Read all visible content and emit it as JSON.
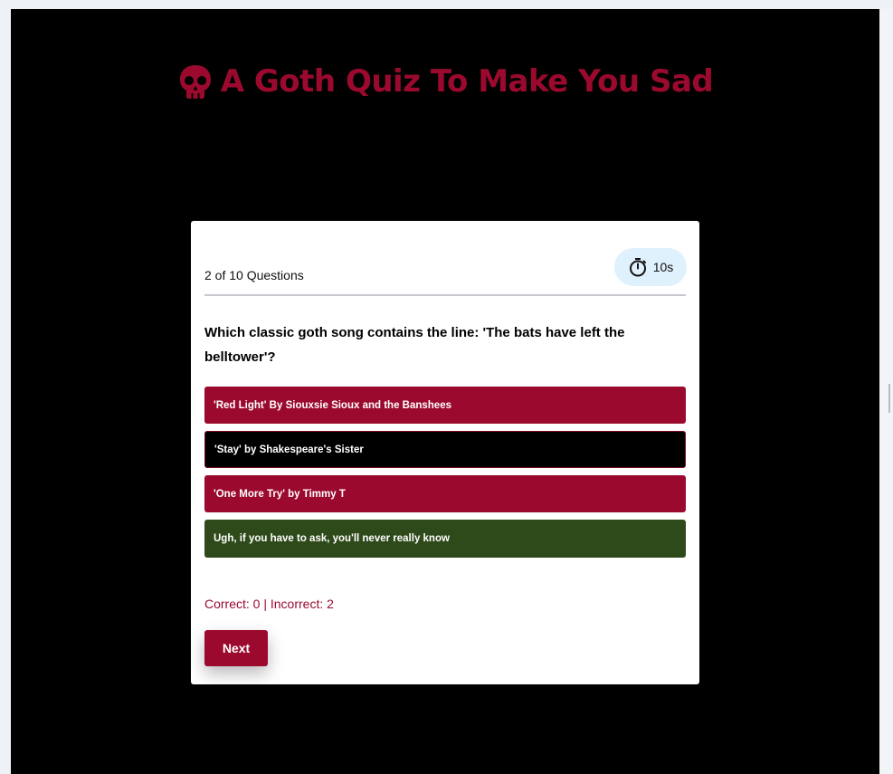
{
  "header": {
    "title": "A Goth Quiz To Make You Sad",
    "icon": "skull-icon"
  },
  "quiz": {
    "progress_text": "2 of 10 Questions",
    "timer_text": "10s",
    "timer_icon": "stopwatch-icon",
    "question": "Which classic goth song contains the line: 'The bats have left the belltower'?",
    "answers": [
      {
        "label": "'Red Light' By Siouxsie Sioux and the Banshees",
        "state": "incorrect"
      },
      {
        "label": "'Stay' by Shakespeare's Sister",
        "state": "default"
      },
      {
        "label": "'One More Try' by Timmy T",
        "state": "incorrect"
      },
      {
        "label": "Ugh, if you have to ask, you'll never really know",
        "state": "correct"
      }
    ],
    "score_text": "Correct: 0 | Incorrect: 2",
    "next_label": "Next"
  },
  "colors": {
    "accent": "#9b0a2e",
    "correct": "#2f4a1a",
    "timer_bg": "#dff1fc",
    "page_bg": "#000000"
  }
}
